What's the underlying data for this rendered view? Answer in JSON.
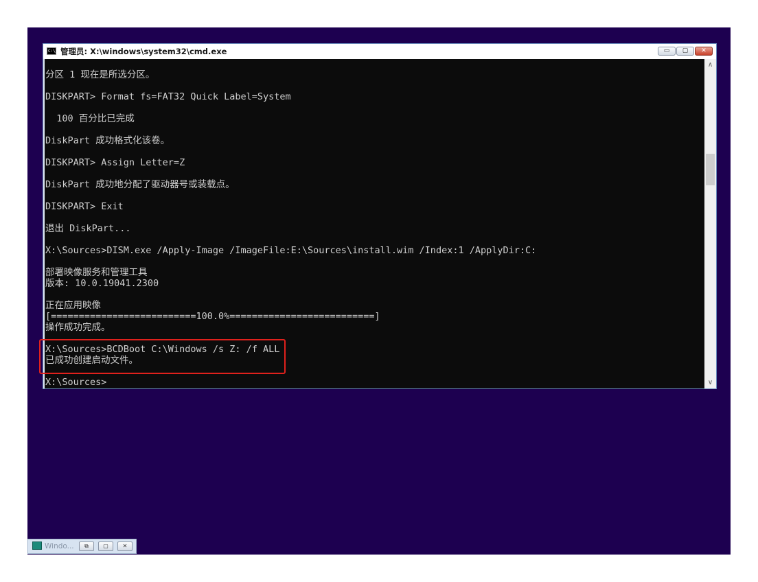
{
  "window": {
    "title": "管理员: X:\\windows\\system32\\cmd.exe",
    "icon_text": "C:\\",
    "controls": {
      "minimize": "▭",
      "maximize": "▢",
      "close": "✕"
    }
  },
  "console": {
    "lines": [
      "分区 1 现在是所选分区。",
      "DISKPART> Format fs=FAT32 Quick Label=System",
      "  100 百分比已完成",
      "DiskPart 成功格式化该卷。",
      "DISKPART> Assign Letter=Z",
      "DiskPart 成功地分配了驱动器号或装载点。",
      "DISKPART> Exit",
      "退出 DiskPart...",
      "X:\\Sources>DISM.exe /Apply-Image /ImageFile:E:\\Sources\\install.wim /Index:1 /ApplyDir:C:",
      "部署映像服务和管理工具",
      "版本: 10.0.19041.2300",
      "正在应用映像",
      "[==========================100.0%==========================]",
      "操作成功完成。",
      "X:\\Sources>BCDBoot C:\\Windows /s Z: /f ALL",
      "已成功创建启动文件。",
      "X:\\Sources>"
    ]
  },
  "scrollbar": {
    "up": "∧",
    "down": "∨"
  },
  "taskbar": {
    "label": "Windo...",
    "buttons": {
      "restore": "⧉",
      "maximize": "▢",
      "close": "✕"
    }
  }
}
